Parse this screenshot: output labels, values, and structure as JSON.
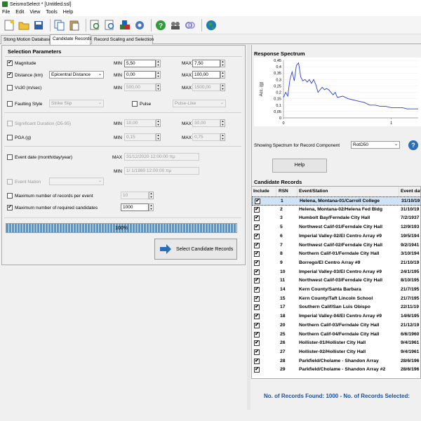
{
  "window": {
    "title": "SeismoSelect * [Untitled.ssl]"
  },
  "menu": [
    "File",
    "Edit",
    "View",
    "Tools",
    "Help"
  ],
  "toolbar": {
    "icons": [
      "new-icon",
      "open-icon",
      "save-icon",
      "copy-icon",
      "paste-icon",
      "find-icon",
      "zoom-icon",
      "cubes-icon",
      "settings-icon",
      "help-icon",
      "film-icon",
      "link-icon",
      "globe-icon"
    ]
  },
  "tabs": [
    "Stong Motion Database",
    "Candidate Records",
    "Record Scaling and Selection"
  ],
  "selection": {
    "title": "Selection Parameters",
    "magnitude": {
      "label": "Magnitude",
      "checked": true,
      "min_label": "MIN",
      "min": "5,50",
      "max_label": "MAX",
      "max": "7,50"
    },
    "distance": {
      "label": "Distance (km)",
      "checked": true,
      "type": "Epicentral Distance",
      "min_label": "MIN",
      "min": "0,00",
      "max_label": "MAX",
      "max": "100,00"
    },
    "vs30": {
      "label": "Vs30 (m/sec)",
      "checked": false,
      "min_label": "MIN",
      "min": "500,00",
      "max_label": "MAX",
      "max": "1500,00"
    },
    "faulting": {
      "label": "Faulting Style",
      "checked": false,
      "value": "Strike Slip"
    },
    "pulse": {
      "label": "Pulse",
      "checked": false,
      "value": "Pulse-Like"
    },
    "duration": {
      "label": "Significant Duration (D5-95)",
      "checked": false,
      "min_label": "MIN",
      "min": "10,00",
      "max_label": "MAX",
      "max": "30,00"
    },
    "pga": {
      "label": "PGA (g)",
      "checked": false,
      "min_label": "MIN",
      "min": "0,15",
      "max_label": "MAX",
      "max": "0,75"
    },
    "event_date": {
      "label": "Event date (month/day/year)",
      "checked": false,
      "max_label": "MAX",
      "max": "31/12/2020  12:00:00 πμ",
      "min_label": "MIN",
      "min": "1/  1/1980  12:00:00 πμ"
    },
    "event_nation": {
      "label": "Event Nation",
      "checked": false,
      "value": ""
    },
    "max_per_event": {
      "label": "Maximum number of records per event",
      "checked": false,
      "value": "10"
    },
    "max_candidates": {
      "label": "Maximum number of required candidates",
      "checked": true,
      "value": "1000"
    },
    "progress": {
      "text": "100%",
      "value": 1.0
    },
    "select_button": "Select Candidate Records"
  },
  "spectrum": {
    "title": "Response Spectrum",
    "showing_label": "Showing Spectrum for Record Component",
    "component": "RotD50",
    "help_button": "Help"
  },
  "chart_data": {
    "type": "line",
    "title": "",
    "xlabel": "",
    "ylabel": "Acc. (g)",
    "x_ticks": [
      "0",
      "1"
    ],
    "y_ticks": [
      "0",
      "0,05",
      "0,1",
      "0,15",
      "0,2",
      "0,25",
      "0,3",
      "0,35",
      "0,4",
      "0,45"
    ],
    "xlim": [
      0,
      1.25
    ],
    "ylim": [
      0,
      0.45
    ],
    "x": [
      0,
      0.02,
      0.04,
      0.06,
      0.08,
      0.1,
      0.12,
      0.14,
      0.16,
      0.18,
      0.2,
      0.22,
      0.24,
      0.26,
      0.28,
      0.3,
      0.32,
      0.34,
      0.36,
      0.38,
      0.4,
      0.42,
      0.44,
      0.46,
      0.48,
      0.5,
      0.55,
      0.6,
      0.65,
      0.7,
      0.75,
      0.8,
      0.85,
      0.9,
      0.95,
      1.0,
      1.05,
      1.1,
      1.15,
      1.2,
      1.25
    ],
    "values": [
      0.16,
      0.2,
      0.17,
      0.3,
      0.36,
      0.29,
      0.41,
      0.43,
      0.32,
      0.29,
      0.3,
      0.28,
      0.3,
      0.27,
      0.3,
      0.26,
      0.2,
      0.22,
      0.24,
      0.22,
      0.23,
      0.22,
      0.2,
      0.18,
      0.2,
      0.16,
      0.17,
      0.15,
      0.14,
      0.13,
      0.12,
      0.1,
      0.1,
      0.09,
      0.09,
      0.08,
      0.08,
      0.08,
      0.07,
      0.07,
      0.07
    ]
  },
  "candidates": {
    "title": "Candidate Records",
    "columns": [
      "Include",
      "RSN",
      "Event/Station",
      "Event date"
    ],
    "rows": [
      {
        "rsn": "1",
        "station": "Helena, Montana-01/Carroll College",
        "date": "31/10/19"
      },
      {
        "rsn": "2",
        "station": "Helena, Montana-02/Helena Fed Bldg",
        "date": "31/10/19"
      },
      {
        "rsn": "3",
        "station": "Humbolt Bay/Ferndale City Hall",
        "date": "7/2/1937"
      },
      {
        "rsn": "5",
        "station": "Northwest Calif-01/Ferndale City Hall",
        "date": "12/9/193"
      },
      {
        "rsn": "6",
        "station": "Imperial Valley-02/El Centro Array #9",
        "date": "19/5/194"
      },
      {
        "rsn": "7",
        "station": "Northwest Calif-02/Ferndale City Hall",
        "date": "9/2/1941"
      },
      {
        "rsn": "8",
        "station": "Northern Calif-01/Ferndale City Hall",
        "date": "3/10/194"
      },
      {
        "rsn": "9",
        "station": "Borrego/El Centro Array #9",
        "date": "21/10/19"
      },
      {
        "rsn": "10",
        "station": "Imperial Valley-03/El Centro Array #9",
        "date": "24/1/195"
      },
      {
        "rsn": "11",
        "station": "Northwest Calif-03/Ferndale City Hall",
        "date": "8/10/195"
      },
      {
        "rsn": "14",
        "station": "Kern County/Santa Barbara",
        "date": "21/7/195"
      },
      {
        "rsn": "15",
        "station": "Kern County/Taft Lincoln School",
        "date": "21/7/195"
      },
      {
        "rsn": "17",
        "station": "Southern Calif/San Luis Obispo",
        "date": "22/11/19"
      },
      {
        "rsn": "18",
        "station": "Imperial Valley-04/El Centro Array #9",
        "date": "14/6/195"
      },
      {
        "rsn": "20",
        "station": "Northern Calif-03/Ferndale City Hall",
        "date": "21/12/19"
      },
      {
        "rsn": "25",
        "station": "Northern Calif-04/Ferndale City Hall",
        "date": "6/6/1960"
      },
      {
        "rsn": "26",
        "station": "Hollister-01/Hollister City Hall",
        "date": "9/4/1961"
      },
      {
        "rsn": "27",
        "station": "Hollister-02/Hollister City Hall",
        "date": "9/4/1961"
      },
      {
        "rsn": "28",
        "station": "Parkfield/Cholame - Shandon Array",
        "date": "28/6/196"
      },
      {
        "rsn": "29",
        "station": "Parkfield/Cholame - Shandon Array #2",
        "date": "28/6/196"
      }
    ]
  },
  "footer": {
    "text": "No. of Records Found: 1000  -  No. of Records Selected:"
  }
}
